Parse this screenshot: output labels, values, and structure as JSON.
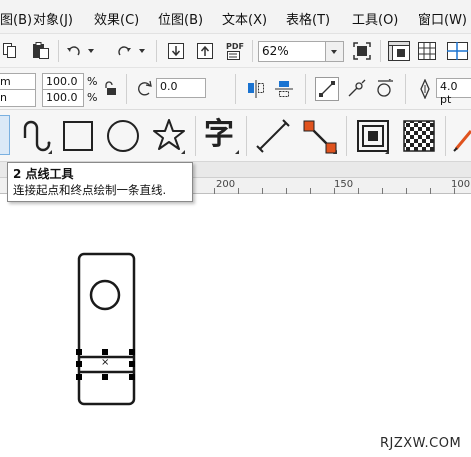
{
  "menubar": {
    "items": [
      {
        "label": "图(B)"
      },
      {
        "label": "对象(J)"
      },
      {
        "label": "效果(C)"
      },
      {
        "label": "位图(B)"
      },
      {
        "label": "文本(X)"
      },
      {
        "label": "表格(T)"
      },
      {
        "label": "工具(O)"
      },
      {
        "label": "窗口(W)"
      }
    ]
  },
  "toolbar1": {
    "zoom_value": "62%",
    "pdf_label": "PDF"
  },
  "toolbar2": {
    "unit_top": "m",
    "unit_bottom": "n",
    "scale_x": "100.0",
    "scale_y": "100.0",
    "percent_top": "%",
    "percent_bottom": "%",
    "rotation": "0.0",
    "outline_width": "4.0 pt"
  },
  "toolbox": {
    "text_tool_glyph": "字"
  },
  "tooltip": {
    "title": "2 点线工具",
    "description": "连接起点和终点绘制一条直线."
  },
  "ruler": {
    "labels": [
      "200",
      "150",
      "100"
    ]
  },
  "canvas": {
    "center_mark": "×"
  },
  "watermark": "RJZXW.COM",
  "colors": {
    "accent": "#1a73d1",
    "orange_node": "#e0531e"
  }
}
